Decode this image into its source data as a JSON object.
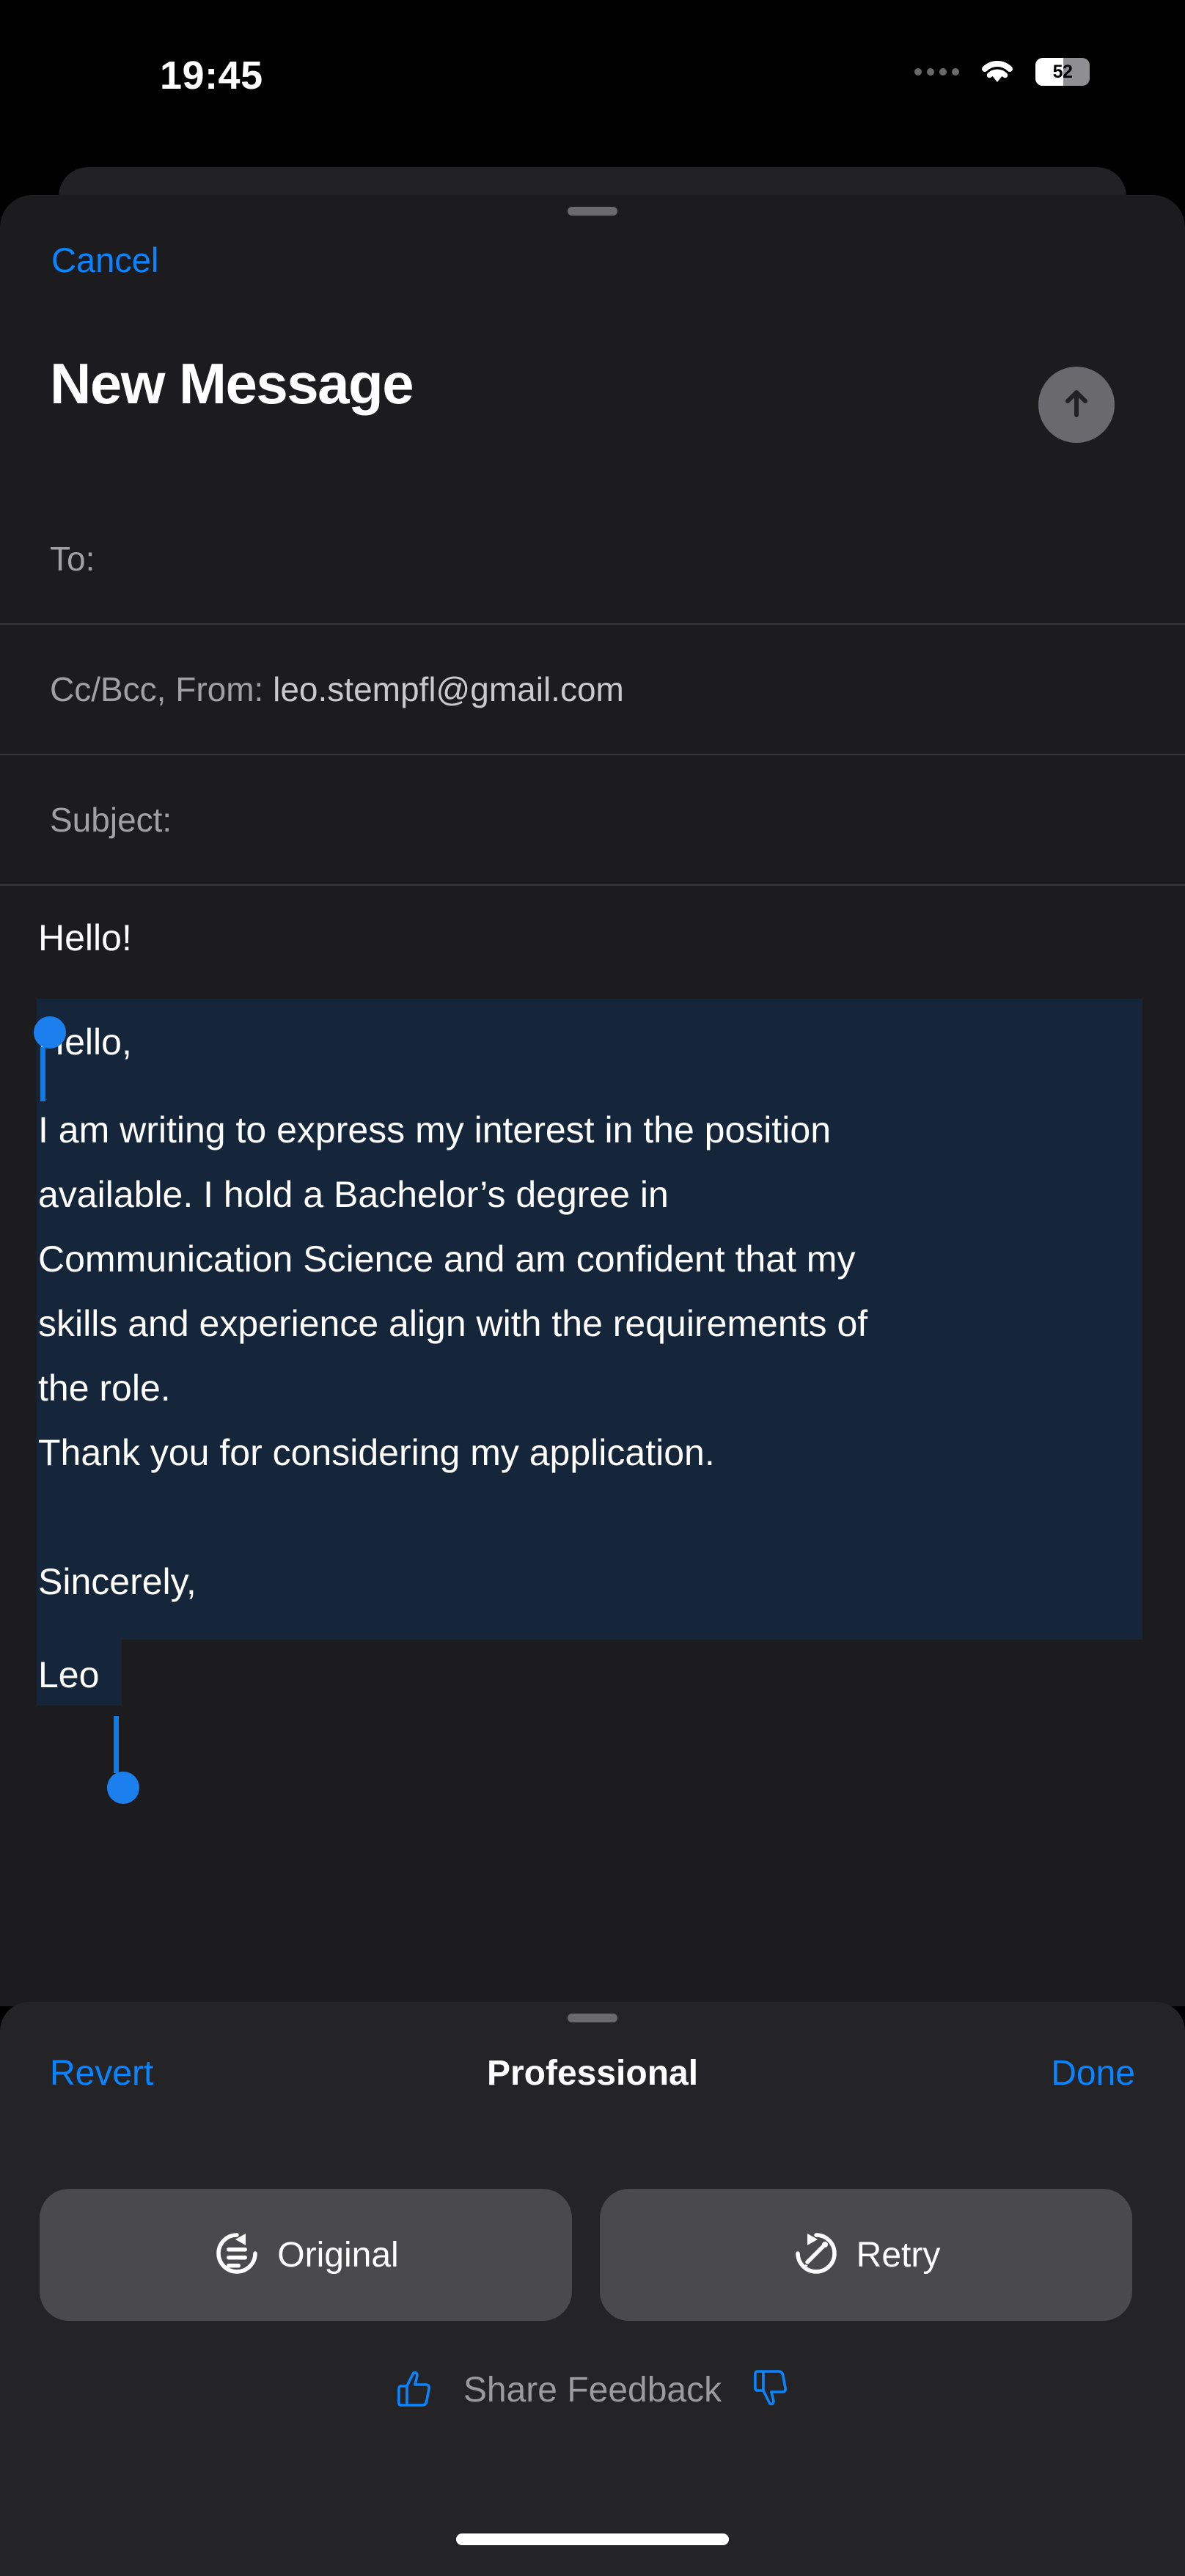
{
  "status_bar": {
    "time": "19:45",
    "cellular_icon": "cellular-dots-icon",
    "wifi_icon": "wifi-icon",
    "battery_percent": "52",
    "battery_icon": "battery-icon"
  },
  "compose_sheet": {
    "grabber_icon": "sheet-grabber-handle",
    "cancel_label": "Cancel",
    "title": "New Message",
    "send_icon": "send-arrow-up-icon",
    "fields": [
      {
        "label": "To:",
        "value": ""
      },
      {
        "label": "Cc/Bcc, From:",
        "value": "leo.stempfl@gmail.com"
      },
      {
        "label": "Subject:",
        "value": ""
      }
    ],
    "body": {
      "unselected_line": "Hello!",
      "selected_lines": [
        "Hello,",
        "I am writing to express my interest in the position",
        "available. I hold a Bachelor’s degree in",
        "Communication Science and am confident that my",
        "skills and experience align with the requirements of",
        "the role.",
        "Thank you for considering my application.",
        "Sincerely,",
        "Leo"
      ],
      "selection_start_handle_icon": "selection-start-handle",
      "selection_end_handle_icon": "selection-end-handle"
    }
  },
  "writing_tools": {
    "grabber_icon": "panel-grabber-handle",
    "revert_label": "Revert",
    "style_label": "Professional",
    "done_label": "Done",
    "actions": [
      {
        "label": "Original",
        "icon": "rewrite-original-circular-arrow-icon"
      },
      {
        "label": "Retry",
        "icon": "retry-circular-arrow-pencil-icon"
      }
    ],
    "feedback": {
      "label": "Share Feedback",
      "thumbs_up_icon": "thumbs-up-icon",
      "thumbs_down_icon": "thumbs-down-icon"
    }
  },
  "system": {
    "home_indicator_icon": "home-indicator"
  },
  "colors": {
    "accent_blue": "#0a84ff",
    "selection_blue": "#15263a",
    "handle_blue": "#1b7fee",
    "sheet_bg": "#1c1c1e",
    "panel_bg": "#242426",
    "pill_bg": "#4a4a4c"
  }
}
